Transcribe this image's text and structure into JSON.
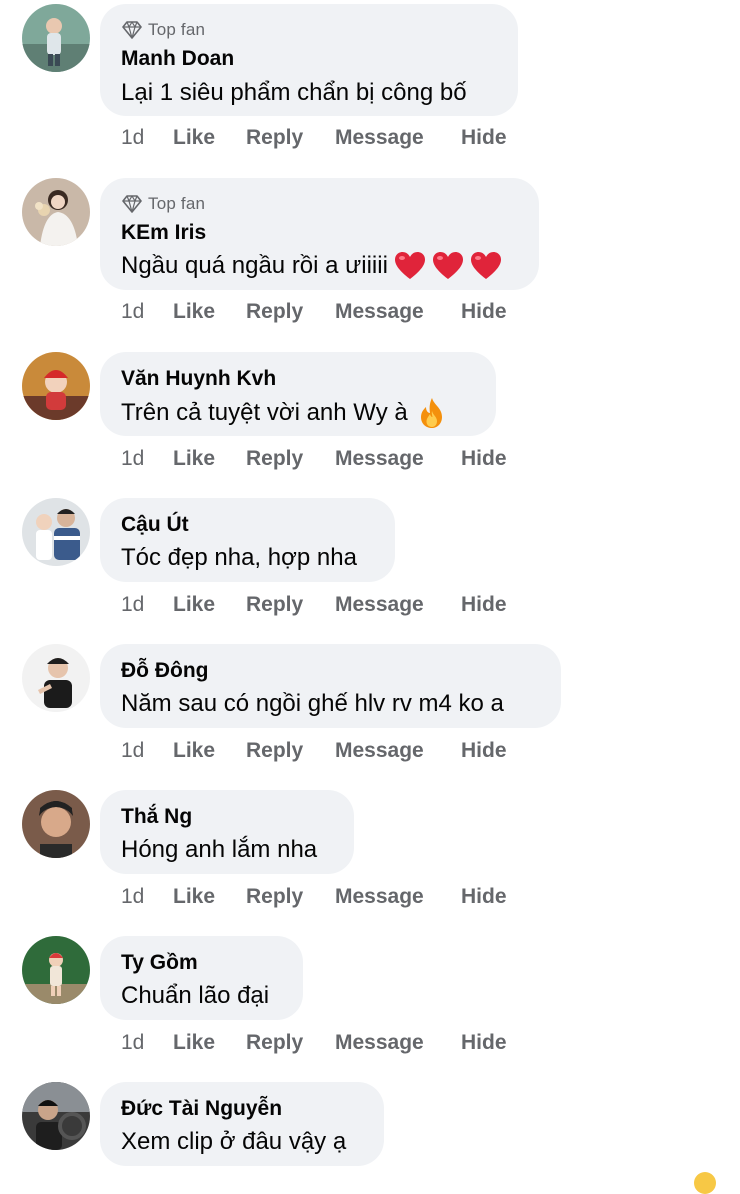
{
  "comments": [
    {
      "badge": "Top fan",
      "author": "Manh Doan",
      "text": "Lại 1 siêu phẩm chẩn bị công bố",
      "emoji": [],
      "time": "1d",
      "actions": {
        "like": "Like",
        "reply": "Reply",
        "message": "Message",
        "hide": "Hide"
      }
    },
    {
      "badge": "Top fan",
      "author": "KEm Iris",
      "text": "Ngầu quá ngầu rồi a ưiiiii",
      "emoji": [
        "heart",
        "heart",
        "heart"
      ],
      "time": "1d",
      "actions": {
        "like": "Like",
        "reply": "Reply",
        "message": "Message",
        "hide": "Hide"
      }
    },
    {
      "badge": "",
      "author": "Văn Huynh Kvh",
      "text": "Trên cả tuyệt vời anh Wy à",
      "emoji": [
        "fire"
      ],
      "time": "1d",
      "actions": {
        "like": "Like",
        "reply": "Reply",
        "message": "Message",
        "hide": "Hide"
      }
    },
    {
      "badge": "",
      "author": "Cậu Út",
      "text": "Tóc đẹp nha, hợp nha",
      "emoji": [],
      "time": "1d",
      "actions": {
        "like": "Like",
        "reply": "Reply",
        "message": "Message",
        "hide": "Hide"
      }
    },
    {
      "badge": "",
      "author": "Đỗ Đông",
      "text": "Năm sau có ngồi ghế hlv rv m4 ko a",
      "emoji": [],
      "time": "1d",
      "actions": {
        "like": "Like",
        "reply": "Reply",
        "message": "Message",
        "hide": "Hide"
      }
    },
    {
      "badge": "",
      "author": "Thắ Ng",
      "text": "Hóng anh lắm nha",
      "emoji": [],
      "time": "1d",
      "actions": {
        "like": "Like",
        "reply": "Reply",
        "message": "Message",
        "hide": "Hide"
      }
    },
    {
      "badge": "",
      "author": "Ty Gồm",
      "text": "Chuẩn lão đại",
      "emoji": [],
      "time": "1d",
      "actions": {
        "like": "Like",
        "reply": "Reply",
        "message": "Message",
        "hide": "Hide"
      }
    },
    {
      "badge": "",
      "author": "Đức Tài Nguyễn",
      "text": "Xem clip ở đâu vậy ạ",
      "emoji": [],
      "time": "",
      "actions": null
    }
  ],
  "colors": {
    "bubble": "#f0f2f5",
    "secondary_text": "#65676b",
    "primary_text": "#050505",
    "heart": "#e0243a",
    "fire": "#f4900c"
  }
}
